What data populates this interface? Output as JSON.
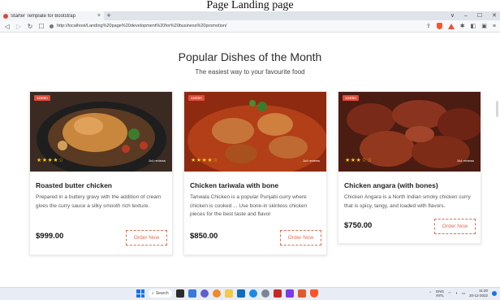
{
  "caption": "Page Landing page",
  "browser": {
    "tab_title": "Starter Template for Bootstrap",
    "tab_close": "×",
    "new_tab": "+",
    "window_controls": [
      "∨",
      "–",
      "☐",
      "✕"
    ],
    "url": "http://localhost/Landing%20page%20development%20for%20business%20promotion/"
  },
  "section": {
    "title": "Popular Dishes of the Month",
    "subtitle": "The easiest way to your favourite food"
  },
  "cards": [
    {
      "badge": "1240m",
      "rating_stars": "★★★★☆",
      "reviews": "1k4 reviews",
      "title": "Roasted butter chicken",
      "description": "Prepared in a buttery gravy with the addition of cream gives the curry sauce a silky smooth rich texture.",
      "price": "$999.00",
      "button": "Order Now"
    },
    {
      "badge": "1240m",
      "rating_stars": "★★★★☆",
      "reviews": "1k4 reviews",
      "title": "Chicken tariwala with bone",
      "description": "Tariwala Chicken is a popular Punjabi curry where chicken is cooked ... Use bone-in skinless chicken pieces for the best taste and flavor",
      "price": "$850.00",
      "button": "Order Now"
    },
    {
      "badge": "1240m",
      "rating_stars": "★★★☆☆",
      "reviews": "1k4 reviews",
      "title": "Chicken angara (with bones)",
      "description": "Chicken Angara is a North Indian smoky chicken curry that is spicy, tangy, and loaded with flavors.",
      "price": "$750.00",
      "button": "Order Now"
    }
  ],
  "taskbar": {
    "search_label": "Search",
    "lang_line1": "ENG",
    "lang_line2": "INTL",
    "time": "11:20",
    "date": "20-12-2022"
  },
  "colors": {
    "accent": "#e46b55",
    "badge": "#e04b3a",
    "star": "#f5c518"
  }
}
